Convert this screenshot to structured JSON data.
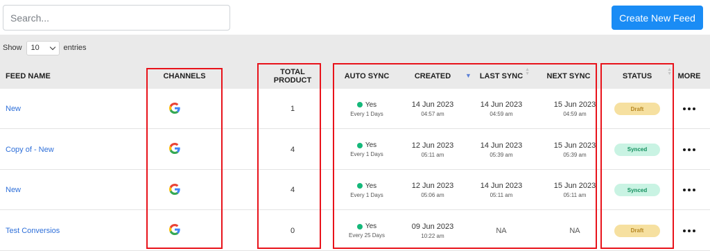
{
  "toolbar": {
    "search_placeholder": "Search...",
    "create_label": "Create New Feed"
  },
  "entries": {
    "show_label": "Show",
    "value": "10",
    "entries_label": "entries"
  },
  "columns": {
    "feed_name": "FEED NAME",
    "channels": "CHANNELS",
    "total_product_line1": "TOTAL",
    "total_product_line2": "PRODUCT",
    "auto_sync": "AUTO SYNC",
    "created": "CREATED",
    "last_sync": "LAST SYNC",
    "next_sync": "NEXT SYNC",
    "status": "STATUS",
    "more": "MORE"
  },
  "rows": [
    {
      "name": "New",
      "channel_icon": "google-icon",
      "total": "1",
      "auto_sync": "Yes",
      "auto_sync_freq": "Every 1 Days",
      "created_date": "14 Jun 2023",
      "created_time": "04:57 am",
      "last_sync_date": "14 Jun 2023",
      "last_sync_time": "04:59 am",
      "next_sync_date": "15 Jun 2023",
      "next_sync_time": "04:59 am",
      "status": "Draft"
    },
    {
      "name": "Copy of - New",
      "channel_icon": "google-icon",
      "total": "4",
      "auto_sync": "Yes",
      "auto_sync_freq": "Every 1 Days",
      "created_date": "12 Jun 2023",
      "created_time": "05:11 am",
      "last_sync_date": "14 Jun 2023",
      "last_sync_time": "05:39 am",
      "next_sync_date": "15 Jun 2023",
      "next_sync_time": "05:39 am",
      "status": "Synced"
    },
    {
      "name": "New",
      "channel_icon": "google-icon",
      "total": "4",
      "auto_sync": "Yes",
      "auto_sync_freq": "Every 1 Days",
      "created_date": "12 Jun 2023",
      "created_time": "05:06 am",
      "last_sync_date": "14 Jun 2023",
      "last_sync_time": "05:11 am",
      "next_sync_date": "15 Jun 2023",
      "next_sync_time": "05:11 am",
      "status": "Synced"
    },
    {
      "name": "Test Conversios",
      "channel_icon": "google-icon",
      "total": "0",
      "auto_sync": "Yes",
      "auto_sync_freq": "Every 25 Days",
      "created_date": "09 Jun 2023",
      "created_time": "10:22 am",
      "last_sync_date": "NA",
      "last_sync_time": "",
      "next_sync_date": "NA",
      "next_sync_time": "",
      "status": "Draft"
    }
  ],
  "colors": {
    "primary": "#1a8cf5",
    "link": "#2e6fd9",
    "draft_bg": "#f6e0a0",
    "synced_bg": "#c9f3e3",
    "sync_dot": "#15b87a",
    "highlight": "#e8121a"
  }
}
